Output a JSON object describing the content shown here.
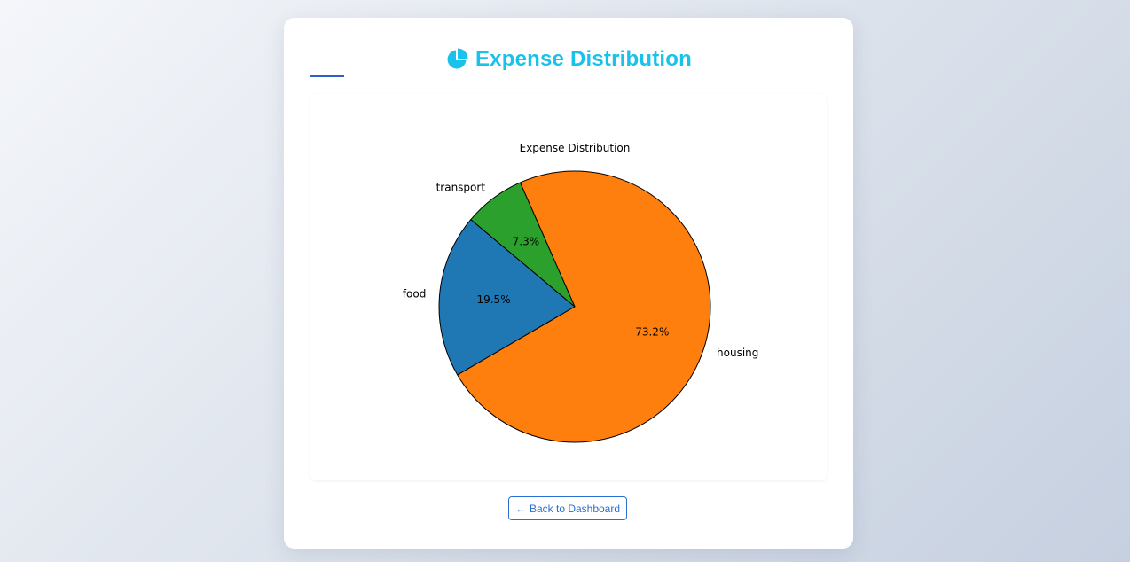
{
  "header": {
    "title": "Expense Distribution",
    "icon": "pie-chart-icon",
    "title_color": "#19c2ea",
    "underline_color": "#2f5fc4"
  },
  "chart_data": {
    "type": "pie",
    "title": "Expense Distribution",
    "start_angle_deg": 140,
    "direction": "counterclockwise",
    "slices": [
      {
        "label": "food",
        "value": 19.5,
        "pct_label": "19.5%",
        "color": "#1f77b4"
      },
      {
        "label": "housing",
        "value": 73.2,
        "pct_label": "73.2%",
        "color": "#ff7f0e"
      },
      {
        "label": "transport",
        "value": 7.3,
        "pct_label": "7.3%",
        "color": "#2ca02c"
      }
    ],
    "edge_color": "#000000"
  },
  "footer": {
    "back_icon": "arrow-left-icon",
    "back_label": "Back to Dashboard",
    "button_color": "#2a6fd6"
  }
}
